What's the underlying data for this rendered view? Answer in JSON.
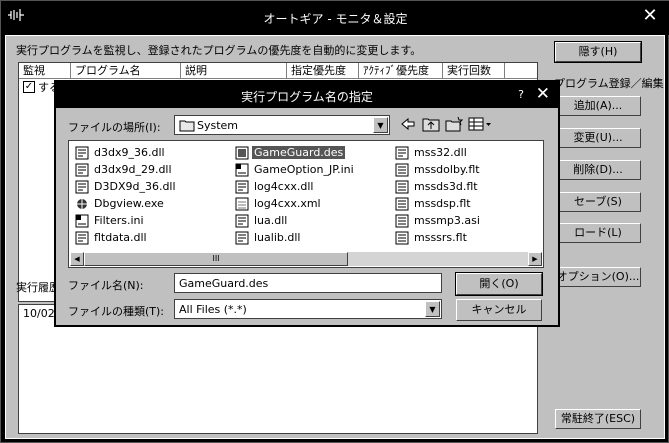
{
  "main": {
    "title": "オートギア - モニタ＆設定",
    "close": "✕",
    "description": "実行プログラムを監視し、登録されたプログラムの優先度を自動的に変更します。",
    "columns": [
      "監視",
      "プログラム名",
      "説明",
      "指定優先度",
      "ｱｸﾃｨﾌﾞ優先度",
      "実行回数"
    ],
    "row1_text": "する",
    "row1_check": "✓",
    "group_label": "プログラム登録／編集",
    "buttons": {
      "hide": "隠す(H)",
      "add": "追加(A)...",
      "change": "変更(U)...",
      "delete": "削除(D)...",
      "save": "セーブ(S)",
      "load": "ロード(L)",
      "options": "オプション(O)...",
      "exit": "常駐終了(ESC)"
    },
    "history_label": "実行履歴",
    "log_line": "10/02/"
  },
  "dialog": {
    "title": "実行プログラム名の指定",
    "help": "?",
    "close": "✕",
    "location_label": "ファイルの場所(I):",
    "location_value": "System",
    "filename_label": "ファイル名(N):",
    "filename_value": "GameGuard.des",
    "filetype_label": "ファイルの種類(T):",
    "filetype_value": "All Files (*.*)",
    "open": "開く(O)",
    "cancel": "キャンセル",
    "scroll_grip": "III",
    "files": [
      {
        "name": "d3dx9_36.dll",
        "icon": "dll-icon"
      },
      {
        "name": "d3dx9d_29.dll",
        "icon": "dll-icon"
      },
      {
        "name": "D3DX9d_36.dll",
        "icon": "dll-icon"
      },
      {
        "name": "Dbgview.exe",
        "icon": "exe-icon"
      },
      {
        "name": "Filters.ini",
        "icon": "ini-icon"
      },
      {
        "name": "fltdata.dll",
        "icon": "dll-icon"
      },
      {
        "name": "GameGuard.des",
        "icon": "des-icon",
        "selected": true
      },
      {
        "name": "GameOption_JP.ini",
        "icon": "ini-icon"
      },
      {
        "name": "log4cxx.dll",
        "icon": "dll-icon"
      },
      {
        "name": "log4cxx.xml",
        "icon": "xml-icon"
      },
      {
        "name": "lua.dll",
        "icon": "dll-icon"
      },
      {
        "name": "lualib.dll",
        "icon": "dll-icon"
      },
      {
        "name": "mss32.dll",
        "icon": "dll-icon"
      },
      {
        "name": "mssdolby.flt",
        "icon": "flt-icon"
      },
      {
        "name": "mssds3d.flt",
        "icon": "flt-icon"
      },
      {
        "name": "mssdsp.flt",
        "icon": "flt-icon"
      },
      {
        "name": "mssmp3.asi",
        "icon": "flt-icon"
      },
      {
        "name": "msssrs.flt",
        "icon": "flt-icon"
      }
    ]
  }
}
